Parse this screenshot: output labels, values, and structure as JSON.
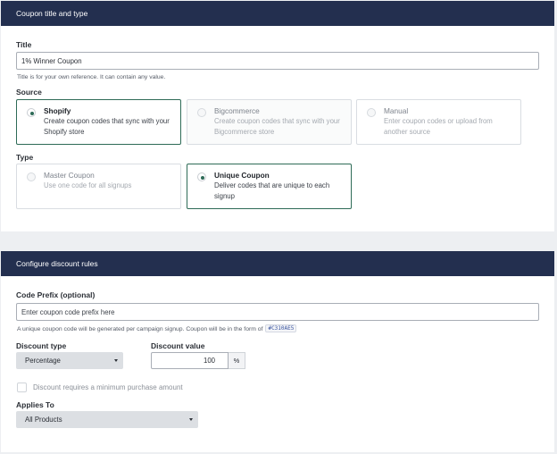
{
  "coupon_section": {
    "header": "Coupon title and type",
    "title_label": "Title",
    "title_value": "1% Winner Coupon",
    "title_help": "Title is for your own reference. It can contain any value.",
    "source_label": "Source",
    "sources": [
      {
        "title": "Shopify",
        "desc": "Create coupon codes that sync with your Shopify store",
        "selected": true
      },
      {
        "title": "Bigcommerce",
        "desc": "Create coupon codes that sync with your Bigcommerce store",
        "selected": false
      },
      {
        "title": "Manual",
        "desc": "Enter coupon codes or upload from another source",
        "selected": false
      }
    ],
    "type_label": "Type",
    "types": [
      {
        "title": "Master Coupon",
        "desc": "Use one code for all signups",
        "selected": false
      },
      {
        "title": "Unique Coupon",
        "desc": "Deliver codes that are unique to each signup",
        "selected": true
      }
    ]
  },
  "discount_section": {
    "header": "Configure discount rules",
    "prefix_label": "Code Prefix (optional)",
    "prefix_placeholder": "Enter coupon code prefix here",
    "prefix_help": "A unique coupon code will be generated per campaign signup. Coupon will be in the form of",
    "prefix_example": "#C310AE5",
    "discount_type_label": "Discount type",
    "discount_type_value": "Percentage",
    "discount_value_label": "Discount value",
    "discount_value": "100",
    "discount_unit": "%",
    "min_purchase_label": "Discount requires a minimum purchase amount",
    "applies_to_label": "Applies To",
    "applies_to_value": "All Products"
  }
}
